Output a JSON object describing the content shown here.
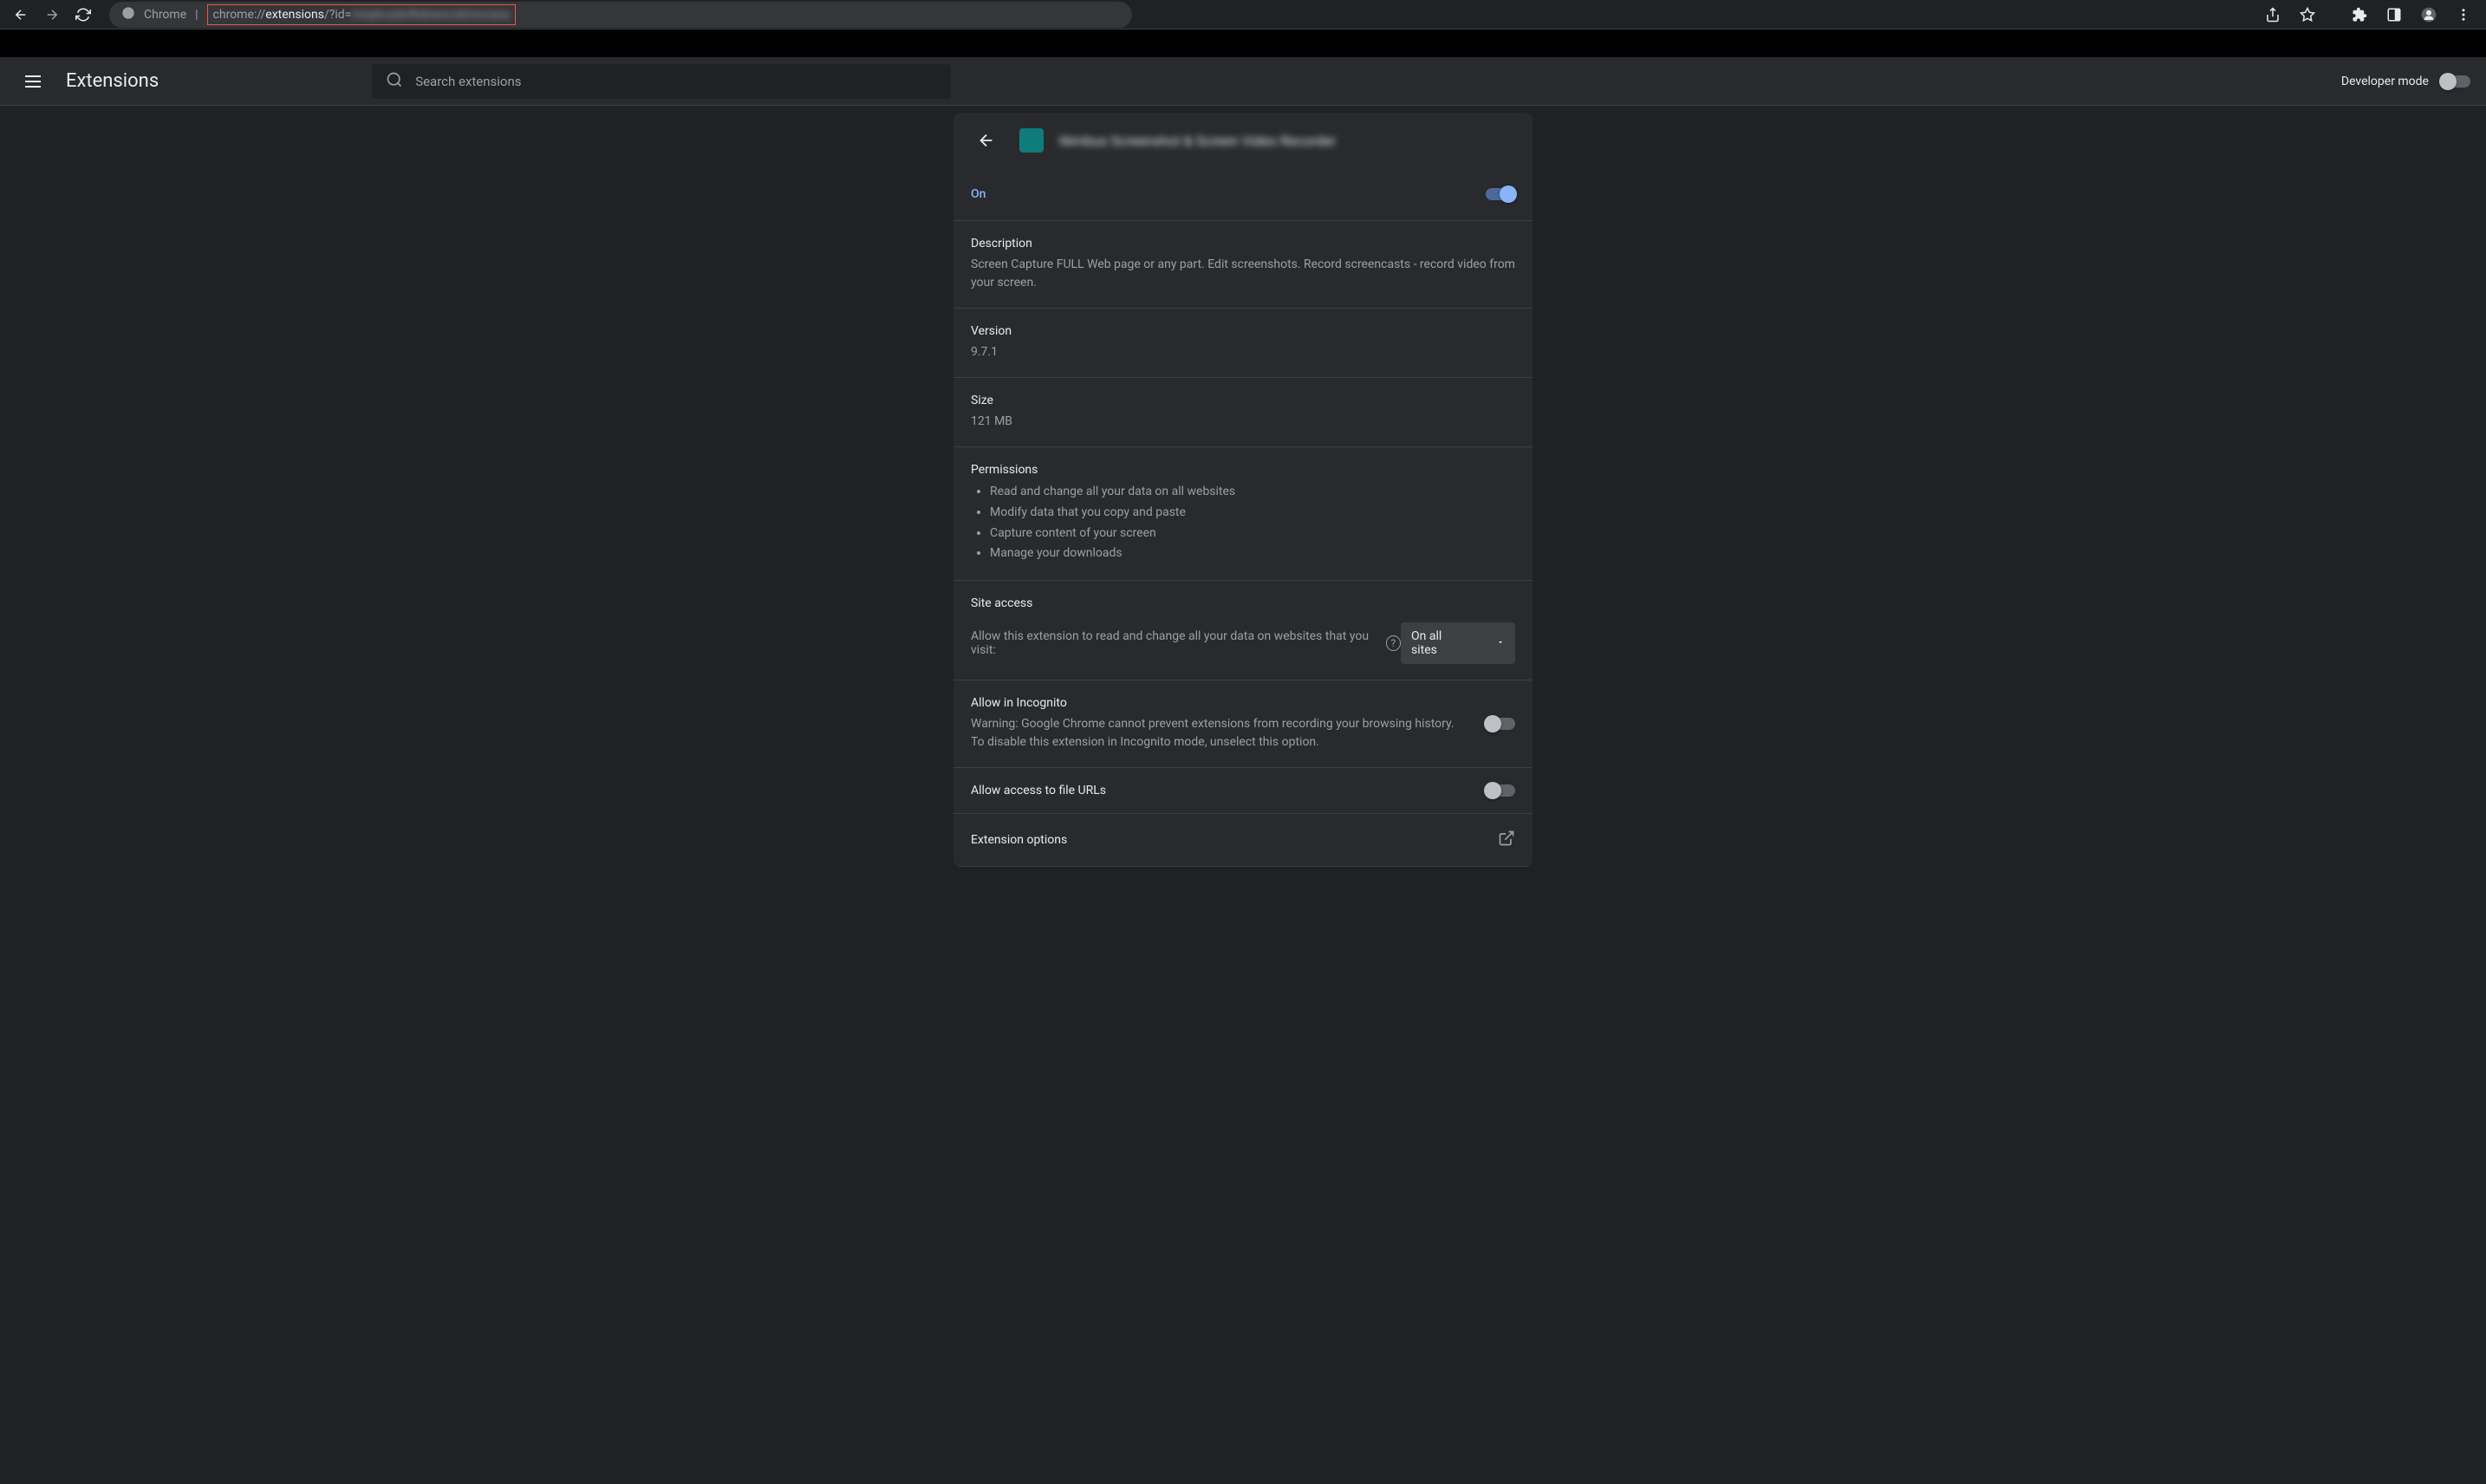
{
  "browser": {
    "profile": "Chrome",
    "url_prefix": "chrome://",
    "url_bold": "extensions",
    "url_suffix": "/?id=",
    "url_obscured": "mnpbcadofkdneocokmocaoa"
  },
  "header": {
    "title": "Extensions",
    "search_placeholder": "Search extensions",
    "dev_mode_label": "Developer mode"
  },
  "extension": {
    "name": "Nimbus Screenshot & Screen Video Recorder",
    "on_label": "On",
    "description_label": "Description",
    "description_text": "Screen Capture FULL Web page or any part. Edit screenshots. Record screencasts - record video from your screen.",
    "version_label": "Version",
    "version_value": "9.7.1",
    "size_label": "Size",
    "size_value": "121 MB",
    "permissions_label": "Permissions",
    "permissions": [
      "Read and change all your data on all websites",
      "Modify data that you copy and paste",
      "Capture content of your screen",
      "Manage your downloads"
    ],
    "site_access_label": "Site access",
    "site_access_desc": "Allow this extension to read and change all your data on websites that you visit:",
    "site_access_value": "On all sites",
    "incognito_label": "Allow in Incognito",
    "incognito_warning": "Warning: Google Chrome cannot prevent extensions from recording your browsing history. To disable this extension in Incognito mode, unselect this option.",
    "file_urls_label": "Allow access to file URLs",
    "options_label": "Extension options"
  }
}
